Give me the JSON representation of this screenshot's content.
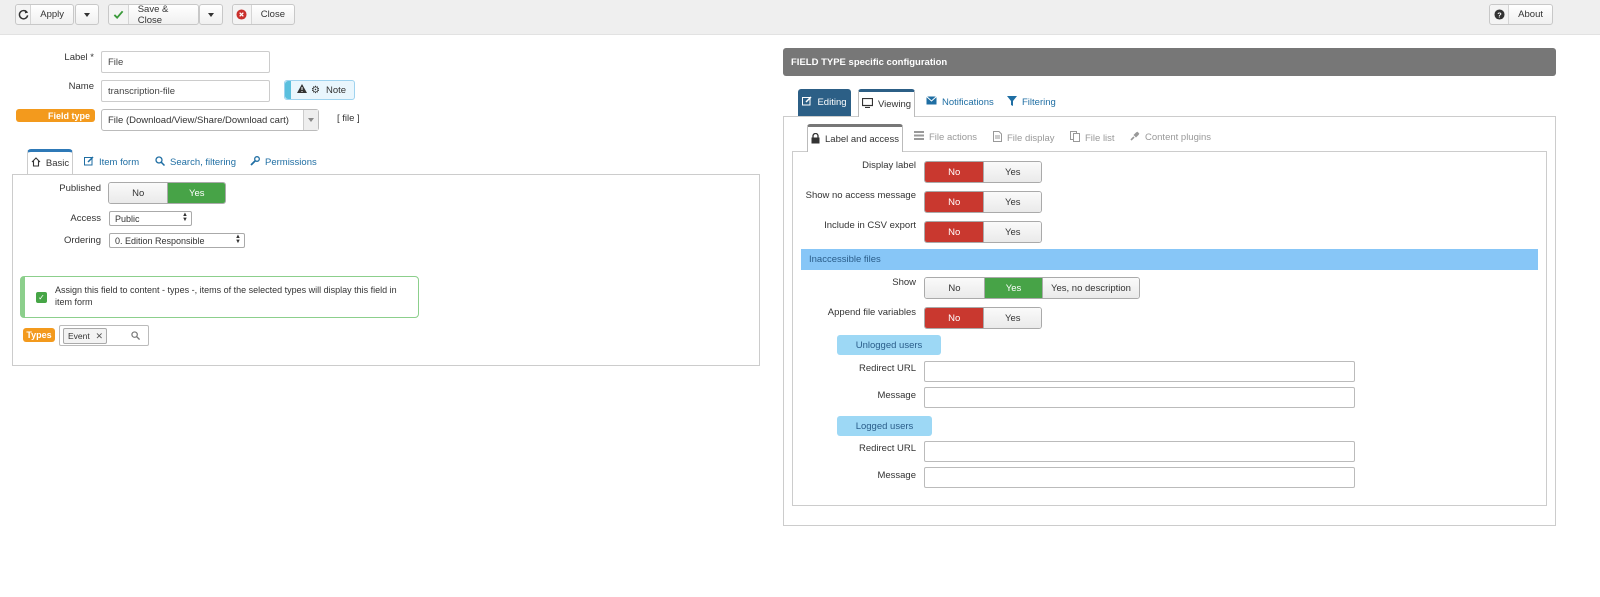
{
  "toolbar": {
    "apply_label": "Apply",
    "save_close_label": "Save & Close",
    "close_label": "Close",
    "about_label": "About"
  },
  "form": {
    "label_field": {
      "label": "Label *",
      "value": "File"
    },
    "name_field": {
      "label": "Name",
      "value": "transcription-file"
    },
    "note_label": "Note",
    "field_type": {
      "label": "Field type",
      "value": "File (Download/View/Share/Download cart)",
      "code": "[ file ]"
    }
  },
  "left_tabs": [
    {
      "label": "Basic",
      "icon": "home-icon"
    },
    {
      "label": "Item form",
      "icon": "edit-icon"
    },
    {
      "label": "Search, filtering",
      "icon": "search-icon"
    },
    {
      "label": "Permissions",
      "icon": "wrench-icon"
    }
  ],
  "basic": {
    "published": {
      "label": "Published",
      "options": [
        "No",
        "Yes"
      ],
      "selected": "Yes"
    },
    "access": {
      "label": "Access",
      "value": "Public"
    },
    "ordering": {
      "label": "Ordering",
      "value": "0. Edition Responsible"
    },
    "assign_text": "Assign this field to content - types -, items of the selected types will display this field in item form",
    "types_label": "Types",
    "types_tag": "Event"
  },
  "right": {
    "header": "FIELD TYPE specific configuration",
    "main_tabs": [
      {
        "label": "Editing",
        "icon": "edit-icon"
      },
      {
        "label": "Viewing",
        "icon": "monitor-icon"
      },
      {
        "label": "Notifications",
        "icon": "envelope-icon"
      },
      {
        "label": "Filtering",
        "icon": "filter-icon"
      }
    ],
    "sub_tabs": [
      {
        "label": "Label and access",
        "icon": "lock-icon"
      },
      {
        "label": "File actions",
        "icon": "list-icon"
      },
      {
        "label": "File display",
        "icon": "file-icon"
      },
      {
        "label": "File list",
        "icon": "copy-icon"
      },
      {
        "label": "Content plugins",
        "icon": "plug-icon"
      }
    ],
    "display_label": {
      "label": "Display label",
      "options": [
        "No",
        "Yes"
      ],
      "selected": "No"
    },
    "show_no_access": {
      "label": "Show no access message",
      "options": [
        "No",
        "Yes"
      ],
      "selected": "No"
    },
    "include_csv": {
      "label": "Include in CSV export",
      "options": [
        "No",
        "Yes"
      ],
      "selected": "No"
    },
    "inaccessible_header": "Inaccessible files",
    "show": {
      "label": "Show",
      "options": [
        "No",
        "Yes",
        "Yes, no description"
      ],
      "selected": "Yes"
    },
    "append_vars": {
      "label": "Append file variables",
      "options": [
        "No",
        "Yes"
      ],
      "selected": "No"
    },
    "unlogged_label": "Unlogged users",
    "logged_label": "Logged users",
    "redirect_url_label": "Redirect URL",
    "message_label": "Message"
  },
  "colors": {
    "accent_blue": "#2e79b7",
    "orange_badge": "#f39a1d",
    "toggle_green": "#47a347",
    "toggle_red": "#c9382f",
    "info_blue": "#87c6f7"
  }
}
